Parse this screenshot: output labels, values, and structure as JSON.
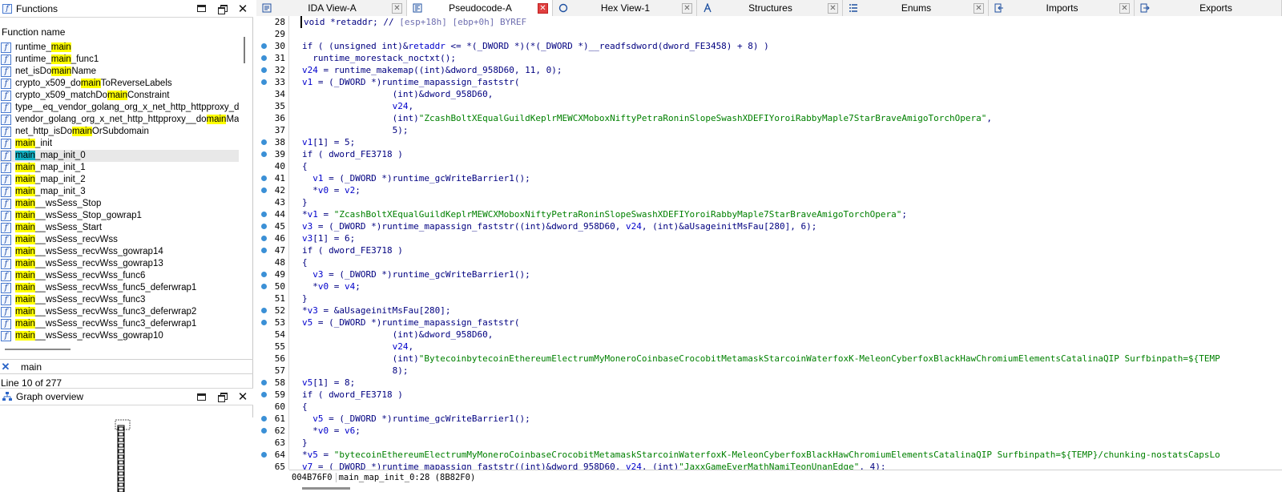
{
  "functions_panel": {
    "title": "Functions",
    "column_header": "Function name",
    "items": [
      {
        "pre": "runtime_",
        "hl": "main",
        "post": ""
      },
      {
        "pre": "runtime_",
        "hl": "main",
        "post": "_func1"
      },
      {
        "pre": "net_isDo",
        "hl": "main",
        "post": "Name"
      },
      {
        "pre": "crypto_x509_do",
        "hl": "main",
        "post": "ToReverseLabels"
      },
      {
        "pre": "crypto_x509_matchDo",
        "hl": "main",
        "post": "Constraint"
      },
      {
        "pre": "type__eq_vendor_golang_org_x_net_http_httpproxy_do",
        "hl": "",
        "post": ""
      },
      {
        "pre": "vendor_golang_org_x_net_http_httpproxy__do",
        "hl": "main",
        "post": "Matc"
      },
      {
        "pre": "net_http_isDo",
        "hl": "main",
        "post": "OrSubdomain"
      },
      {
        "pre": "",
        "hl": "main",
        "post": "_init"
      },
      {
        "pre": "",
        "hl": "main",
        "post": "_map_init_0",
        "selected": true
      },
      {
        "pre": "",
        "hl": "main",
        "post": "_map_init_1"
      },
      {
        "pre": "",
        "hl": "main",
        "post": "_map_init_2"
      },
      {
        "pre": "",
        "hl": "main",
        "post": "_map_init_3"
      },
      {
        "pre": "",
        "hl": "main",
        "post": "__wsSess_Stop"
      },
      {
        "pre": "",
        "hl": "main",
        "post": "__wsSess_Stop_gowrap1"
      },
      {
        "pre": "",
        "hl": "main",
        "post": "__wsSess_Start"
      },
      {
        "pre": "",
        "hl": "main",
        "post": "__wsSess_recvWss"
      },
      {
        "pre": "",
        "hl": "main",
        "post": "__wsSess_recvWss_gowrap14"
      },
      {
        "pre": "",
        "hl": "main",
        "post": "__wsSess_recvWss_gowrap13"
      },
      {
        "pre": "",
        "hl": "main",
        "post": "__wsSess_recvWss_func6"
      },
      {
        "pre": "",
        "hl": "main",
        "post": "__wsSess_recvWss_func5_deferwrap1"
      },
      {
        "pre": "",
        "hl": "main",
        "post": "__wsSess_recvWss_func3"
      },
      {
        "pre": "",
        "hl": "main",
        "post": "__wsSess_recvWss_func3_deferwrap2"
      },
      {
        "pre": "",
        "hl": "main",
        "post": "__wsSess_recvWss_func3_deferwrap1"
      },
      {
        "pre": "",
        "hl": "main",
        "post": "__wsSess_recvWss_gowrap10"
      }
    ],
    "filter_value": "main",
    "line_status": "Line 10 of 277"
  },
  "graph_panel": {
    "title": "Graph overview"
  },
  "tabs": [
    {
      "label": "IDA View-A",
      "active": false,
      "icon": "ida-view-icon"
    },
    {
      "label": "Pseudocode-A",
      "active": true,
      "icon": "pseudocode-icon"
    },
    {
      "label": "Hex View-1",
      "active": false,
      "icon": "hex-view-icon"
    },
    {
      "label": "Structures",
      "active": false,
      "icon": "structures-icon"
    },
    {
      "label": "Enums",
      "active": false,
      "icon": "enums-icon"
    },
    {
      "label": "Imports",
      "active": false,
      "icon": "imports-icon"
    },
    {
      "label": "Exports",
      "active": false,
      "icon": "exports-icon"
    }
  ],
  "code": {
    "lines": [
      {
        "n": "28",
        "dot": false,
        "segs": [
          [
            "void *retaddr; // ",
            ""
          ],
          [
            "[esp+18h] [ebp+0h] BYREF",
            "cmt"
          ]
        ]
      },
      {
        "n": "29",
        "dot": false,
        "segs": []
      },
      {
        "n": "30",
        "dot": true,
        "segs": [
          [
            "if ( (unsigned int)&",
            ""
          ],
          [
            "retaddr",
            "var"
          ],
          [
            " <= *(_DWORD *)(*(_DWORD *)__readfsdword(dword_FE3458) + 8) )",
            ""
          ]
        ]
      },
      {
        "n": "31",
        "dot": true,
        "segs": [
          [
            "  runtime_morestack_noctxt();",
            ""
          ]
        ]
      },
      {
        "n": "32",
        "dot": true,
        "segs": [
          [
            "v24",
            "var"
          ],
          [
            " = runtime_makemap((int)&dword_958D60, 11, 0);",
            ""
          ]
        ]
      },
      {
        "n": "33",
        "dot": true,
        "segs": [
          [
            "v1",
            "var"
          ],
          [
            " = (_DWORD *)runtime_mapassign_faststr(",
            ""
          ]
        ]
      },
      {
        "n": "34",
        "dot": false,
        "segs": [
          [
            "                 (int)&dword_958D60,",
            ""
          ]
        ]
      },
      {
        "n": "35",
        "dot": false,
        "segs": [
          [
            "                 ",
            ""
          ],
          [
            "v24",
            "var"
          ],
          [
            ",",
            ""
          ]
        ]
      },
      {
        "n": "36",
        "dot": false,
        "segs": [
          [
            "                 (int)",
            ""
          ],
          [
            "\"ZcashBoltXEqualGuildKeplrMEWCXMoboxNiftyPetraRoninSlopeSwashXDEFIYoroiRabbyMaple7StarBraveAmigoTorchOpera\"",
            "str"
          ],
          [
            ",",
            ""
          ]
        ]
      },
      {
        "n": "37",
        "dot": false,
        "segs": [
          [
            "                 5);",
            ""
          ]
        ]
      },
      {
        "n": "38",
        "dot": true,
        "segs": [
          [
            "v1",
            "var"
          ],
          [
            "[1] = 5;",
            ""
          ]
        ]
      },
      {
        "n": "39",
        "dot": true,
        "segs": [
          [
            "if ( dword_FE3718 )",
            ""
          ]
        ]
      },
      {
        "n": "40",
        "dot": false,
        "segs": [
          [
            "{",
            ""
          ]
        ]
      },
      {
        "n": "41",
        "dot": true,
        "segs": [
          [
            "  ",
            ""
          ],
          [
            "v1",
            "var"
          ],
          [
            " = (_DWORD *)runtime_gcWriteBarrier1();",
            ""
          ]
        ]
      },
      {
        "n": "42",
        "dot": true,
        "segs": [
          [
            "  *",
            ""
          ],
          [
            "v0",
            "var"
          ],
          [
            " = ",
            ""
          ],
          [
            "v2",
            "var"
          ],
          [
            ";",
            ""
          ]
        ]
      },
      {
        "n": "43",
        "dot": false,
        "segs": [
          [
            "}",
            ""
          ]
        ]
      },
      {
        "n": "44",
        "dot": true,
        "segs": [
          [
            "*",
            ""
          ],
          [
            "v1",
            "var"
          ],
          [
            " = ",
            ""
          ],
          [
            "\"ZcashBoltXEqualGuildKeplrMEWCXMoboxNiftyPetraRoninSlopeSwashXDEFIYoroiRabbyMaple7StarBraveAmigoTorchOpera\"",
            "str"
          ],
          [
            ";",
            ""
          ]
        ]
      },
      {
        "n": "45",
        "dot": true,
        "segs": [
          [
            "v3",
            "var"
          ],
          [
            " = (_DWORD *)runtime_mapassign_faststr((int)&dword_958D60, ",
            ""
          ],
          [
            "v24",
            "var"
          ],
          [
            ", (int)&aUsageinitMsFau[280], 6);",
            ""
          ]
        ]
      },
      {
        "n": "46",
        "dot": true,
        "segs": [
          [
            "v3",
            "var"
          ],
          [
            "[1] = 6;",
            ""
          ]
        ]
      },
      {
        "n": "47",
        "dot": true,
        "segs": [
          [
            "if ( dword_FE3718 )",
            ""
          ]
        ]
      },
      {
        "n": "48",
        "dot": false,
        "segs": [
          [
            "{",
            ""
          ]
        ]
      },
      {
        "n": "49",
        "dot": true,
        "segs": [
          [
            "  ",
            ""
          ],
          [
            "v3",
            "var"
          ],
          [
            " = (_DWORD *)runtime_gcWriteBarrier1();",
            ""
          ]
        ]
      },
      {
        "n": "50",
        "dot": true,
        "segs": [
          [
            "  *",
            ""
          ],
          [
            "v0",
            "var"
          ],
          [
            " = ",
            ""
          ],
          [
            "v4",
            "var"
          ],
          [
            ";",
            ""
          ]
        ]
      },
      {
        "n": "51",
        "dot": false,
        "segs": [
          [
            "}",
            ""
          ]
        ]
      },
      {
        "n": "52",
        "dot": true,
        "segs": [
          [
            "*",
            ""
          ],
          [
            "v3",
            "var"
          ],
          [
            " = &aUsageinitMsFau[280];",
            ""
          ]
        ]
      },
      {
        "n": "53",
        "dot": true,
        "segs": [
          [
            "v5",
            "var"
          ],
          [
            " = (_DWORD *)runtime_mapassign_faststr(",
            ""
          ]
        ]
      },
      {
        "n": "54",
        "dot": false,
        "segs": [
          [
            "                 (int)&dword_958D60,",
            ""
          ]
        ]
      },
      {
        "n": "55",
        "dot": false,
        "segs": [
          [
            "                 ",
            ""
          ],
          [
            "v24",
            "var"
          ],
          [
            ",",
            ""
          ]
        ]
      },
      {
        "n": "56",
        "dot": false,
        "segs": [
          [
            "                 (int)",
            ""
          ],
          [
            "\"BytecoinbytecoinEthereumElectrumMyMoneroCoinbaseCrocobitMetamaskStarcoinWaterfoxK-MeleonCyberfoxBlackHawChromiumElementsCatalinaQIP Surfbinpath=${TEMP",
            "str"
          ]
        ]
      },
      {
        "n": "57",
        "dot": false,
        "segs": [
          [
            "                 8);",
            ""
          ]
        ]
      },
      {
        "n": "58",
        "dot": true,
        "segs": [
          [
            "v5",
            "var"
          ],
          [
            "[1] = 8;",
            ""
          ]
        ]
      },
      {
        "n": "59",
        "dot": true,
        "segs": [
          [
            "if ( dword_FE3718 )",
            ""
          ]
        ]
      },
      {
        "n": "60",
        "dot": false,
        "segs": [
          [
            "{",
            ""
          ]
        ]
      },
      {
        "n": "61",
        "dot": true,
        "segs": [
          [
            "  ",
            ""
          ],
          [
            "v5",
            "var"
          ],
          [
            " = (_DWORD *)runtime_gcWriteBarrier1();",
            ""
          ]
        ]
      },
      {
        "n": "62",
        "dot": true,
        "segs": [
          [
            "  *",
            ""
          ],
          [
            "v0",
            "var"
          ],
          [
            " = ",
            ""
          ],
          [
            "v6",
            "var"
          ],
          [
            ";",
            ""
          ]
        ]
      },
      {
        "n": "63",
        "dot": false,
        "segs": [
          [
            "}",
            ""
          ]
        ]
      },
      {
        "n": "64",
        "dot": true,
        "segs": [
          [
            "*",
            ""
          ],
          [
            "v5",
            "var"
          ],
          [
            " = ",
            ""
          ],
          [
            "\"bytecoinEthereumElectrumMyMoneroCoinbaseCrocobitMetamaskStarcoinWaterfoxK-MeleonCyberfoxBlackHawChromiumElementsCatalinaQIP Surfbinpath=${TEMP}/chunking-nostatsCapsLo",
            "str"
          ]
        ]
      },
      {
        "n": "65",
        "dot": false,
        "segs": [
          [
            "v7",
            "var"
          ],
          [
            " = (_DWORD *)runtime_mapassign_faststr((int)&dword_958D60, ",
            ""
          ],
          [
            "v24",
            "var"
          ],
          [
            ", (int)",
            ""
          ],
          [
            "\"JaxxGameEverMathNamiTeonUnanEdge\"",
            "str"
          ],
          [
            ", 4);",
            ""
          ]
        ]
      }
    ]
  },
  "status": {
    "address": "004B76F0",
    "location": "main_map_init_0:28 (8B82F0)"
  },
  "colors": {
    "highlight": "#ffff00",
    "selected_highlight": "#12b1c4",
    "string_literal": "#008000",
    "identifier": "#000080",
    "breakpoint_dot": "#3b90d6",
    "active_tab_close": "#e04040"
  }
}
